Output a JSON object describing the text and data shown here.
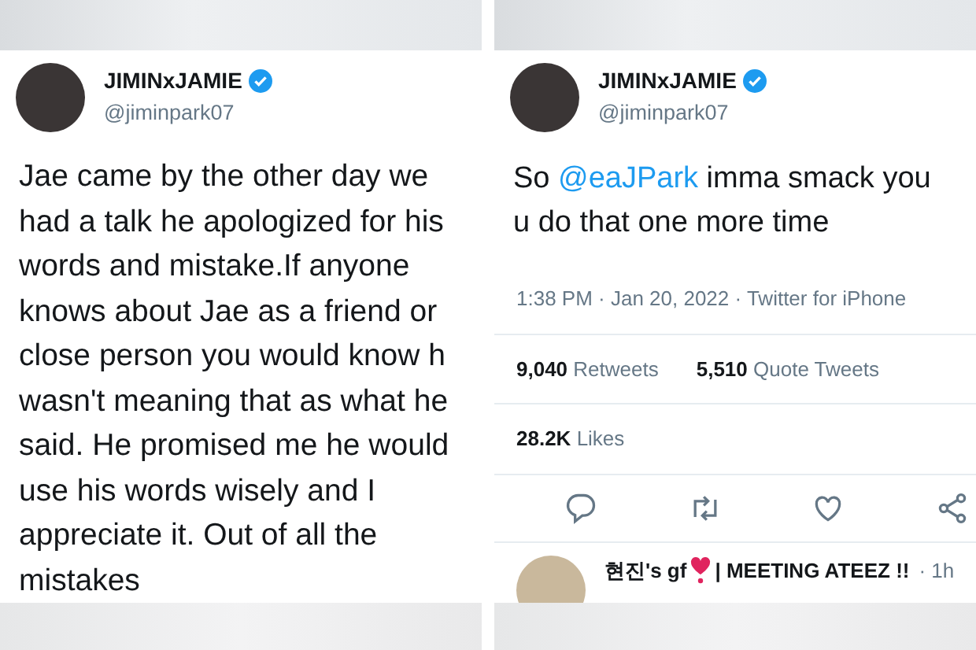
{
  "tweets": [
    {
      "display_name": "JIMINxJAMIE",
      "handle": "@jiminpark07",
      "verified": true,
      "lines": [
        [
          {
            "kind": "plain",
            "text": "Jae came by the other day we"
          }
        ],
        [
          {
            "kind": "plain",
            "text": "had a talk he apologized for his"
          }
        ],
        [
          {
            "kind": "plain",
            "text": "words and mistake.If anyone"
          }
        ],
        [
          {
            "kind": "plain",
            "text": "knows about Jae as a friend or"
          }
        ],
        [
          {
            "kind": "plain",
            "text": "close person you would know h"
          }
        ],
        [
          {
            "kind": "plain",
            "text": "wasn't meaning that as what he"
          }
        ],
        [
          {
            "kind": "plain",
            "text": "said. He promised me he would"
          }
        ],
        [
          {
            "kind": "plain",
            "text": "use his words wisely and I"
          }
        ],
        [
          {
            "kind": "plain",
            "text": "appreciate it. Out of all the"
          }
        ],
        [
          {
            "kind": "plain",
            "text": "mistakes"
          }
        ]
      ]
    },
    {
      "display_name": "JIMINxJAMIE",
      "handle": "@jiminpark07",
      "verified": true,
      "lines": [
        [
          {
            "kind": "plain",
            "text": "So "
          },
          {
            "kind": "mention",
            "text": "@eaJPark"
          },
          {
            "kind": "plain",
            "text": " imma smack you"
          }
        ],
        [
          {
            "kind": "plain",
            "text": "u do that one more time"
          }
        ]
      ],
      "timestamp": "1:38 PM · Jan 20, 2022 · Twitter for iPhone",
      "stat_rows": [
        [
          "**9,040** Retweets",
          "**5,510** Quote Tweets"
        ],
        [
          "**28.2K** Likes"
        ]
      ],
      "actions": [
        {
          "kind": "reply"
        },
        {
          "kind": "retweet"
        },
        {
          "kind": "like"
        },
        {
          "kind": "share"
        }
      ],
      "reply": {
        "name": "현진's gf",
        "tagline": "| MEETING ATEEZ !!",
        "time": "· 1h"
      }
    }
  ]
}
